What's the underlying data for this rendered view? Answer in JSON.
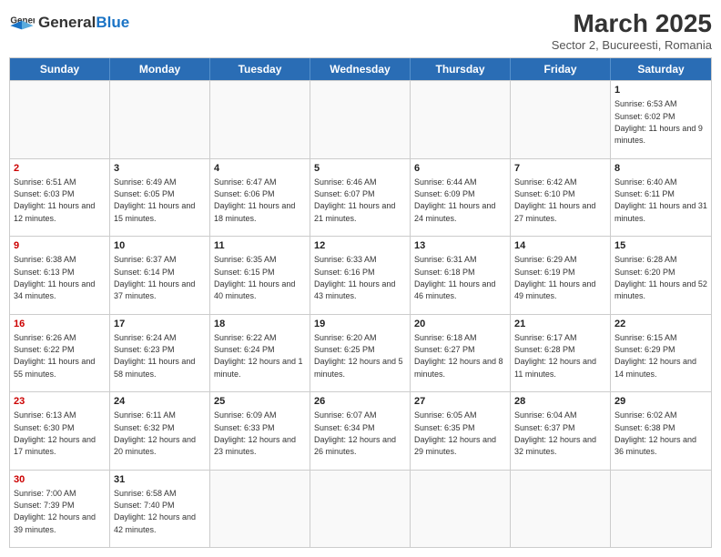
{
  "header": {
    "logo_general": "General",
    "logo_blue": "Blue",
    "month_title": "March 2025",
    "subtitle": "Sector 2, Bucureesti, Romania"
  },
  "days_of_week": [
    "Sunday",
    "Monday",
    "Tuesday",
    "Wednesday",
    "Thursday",
    "Friday",
    "Saturday"
  ],
  "weeks": [
    [
      {
        "day": "",
        "info": ""
      },
      {
        "day": "",
        "info": ""
      },
      {
        "day": "",
        "info": ""
      },
      {
        "day": "",
        "info": ""
      },
      {
        "day": "",
        "info": ""
      },
      {
        "day": "",
        "info": ""
      },
      {
        "day": "1",
        "info": "Sunrise: 6:53 AM\nSunset: 6:02 PM\nDaylight: 11 hours and 9 minutes."
      }
    ],
    [
      {
        "day": "2",
        "info": "Sunrise: 6:51 AM\nSunset: 6:03 PM\nDaylight: 11 hours and 12 minutes."
      },
      {
        "day": "3",
        "info": "Sunrise: 6:49 AM\nSunset: 6:05 PM\nDaylight: 11 hours and 15 minutes."
      },
      {
        "day": "4",
        "info": "Sunrise: 6:47 AM\nSunset: 6:06 PM\nDaylight: 11 hours and 18 minutes."
      },
      {
        "day": "5",
        "info": "Sunrise: 6:46 AM\nSunset: 6:07 PM\nDaylight: 11 hours and 21 minutes."
      },
      {
        "day": "6",
        "info": "Sunrise: 6:44 AM\nSunset: 6:09 PM\nDaylight: 11 hours and 24 minutes."
      },
      {
        "day": "7",
        "info": "Sunrise: 6:42 AM\nSunset: 6:10 PM\nDaylight: 11 hours and 27 minutes."
      },
      {
        "day": "8",
        "info": "Sunrise: 6:40 AM\nSunset: 6:11 PM\nDaylight: 11 hours and 31 minutes."
      }
    ],
    [
      {
        "day": "9",
        "info": "Sunrise: 6:38 AM\nSunset: 6:13 PM\nDaylight: 11 hours and 34 minutes."
      },
      {
        "day": "10",
        "info": "Sunrise: 6:37 AM\nSunset: 6:14 PM\nDaylight: 11 hours and 37 minutes."
      },
      {
        "day": "11",
        "info": "Sunrise: 6:35 AM\nSunset: 6:15 PM\nDaylight: 11 hours and 40 minutes."
      },
      {
        "day": "12",
        "info": "Sunrise: 6:33 AM\nSunset: 6:16 PM\nDaylight: 11 hours and 43 minutes."
      },
      {
        "day": "13",
        "info": "Sunrise: 6:31 AM\nSunset: 6:18 PM\nDaylight: 11 hours and 46 minutes."
      },
      {
        "day": "14",
        "info": "Sunrise: 6:29 AM\nSunset: 6:19 PM\nDaylight: 11 hours and 49 minutes."
      },
      {
        "day": "15",
        "info": "Sunrise: 6:28 AM\nSunset: 6:20 PM\nDaylight: 11 hours and 52 minutes."
      }
    ],
    [
      {
        "day": "16",
        "info": "Sunrise: 6:26 AM\nSunset: 6:22 PM\nDaylight: 11 hours and 55 minutes."
      },
      {
        "day": "17",
        "info": "Sunrise: 6:24 AM\nSunset: 6:23 PM\nDaylight: 11 hours and 58 minutes."
      },
      {
        "day": "18",
        "info": "Sunrise: 6:22 AM\nSunset: 6:24 PM\nDaylight: 12 hours and 1 minute."
      },
      {
        "day": "19",
        "info": "Sunrise: 6:20 AM\nSunset: 6:25 PM\nDaylight: 12 hours and 5 minutes."
      },
      {
        "day": "20",
        "info": "Sunrise: 6:18 AM\nSunset: 6:27 PM\nDaylight: 12 hours and 8 minutes."
      },
      {
        "day": "21",
        "info": "Sunrise: 6:17 AM\nSunset: 6:28 PM\nDaylight: 12 hours and 11 minutes."
      },
      {
        "day": "22",
        "info": "Sunrise: 6:15 AM\nSunset: 6:29 PM\nDaylight: 12 hours and 14 minutes."
      }
    ],
    [
      {
        "day": "23",
        "info": "Sunrise: 6:13 AM\nSunset: 6:30 PM\nDaylight: 12 hours and 17 minutes."
      },
      {
        "day": "24",
        "info": "Sunrise: 6:11 AM\nSunset: 6:32 PM\nDaylight: 12 hours and 20 minutes."
      },
      {
        "day": "25",
        "info": "Sunrise: 6:09 AM\nSunset: 6:33 PM\nDaylight: 12 hours and 23 minutes."
      },
      {
        "day": "26",
        "info": "Sunrise: 6:07 AM\nSunset: 6:34 PM\nDaylight: 12 hours and 26 minutes."
      },
      {
        "day": "27",
        "info": "Sunrise: 6:05 AM\nSunset: 6:35 PM\nDaylight: 12 hours and 29 minutes."
      },
      {
        "day": "28",
        "info": "Sunrise: 6:04 AM\nSunset: 6:37 PM\nDaylight: 12 hours and 32 minutes."
      },
      {
        "day": "29",
        "info": "Sunrise: 6:02 AM\nSunset: 6:38 PM\nDaylight: 12 hours and 36 minutes."
      }
    ],
    [
      {
        "day": "30",
        "info": "Sunrise: 7:00 AM\nSunset: 7:39 PM\nDaylight: 12 hours and 39 minutes."
      },
      {
        "day": "31",
        "info": "Sunrise: 6:58 AM\nSunset: 7:40 PM\nDaylight: 12 hours and 42 minutes."
      },
      {
        "day": "",
        "info": ""
      },
      {
        "day": "",
        "info": ""
      },
      {
        "day": "",
        "info": ""
      },
      {
        "day": "",
        "info": ""
      },
      {
        "day": "",
        "info": ""
      }
    ]
  ]
}
